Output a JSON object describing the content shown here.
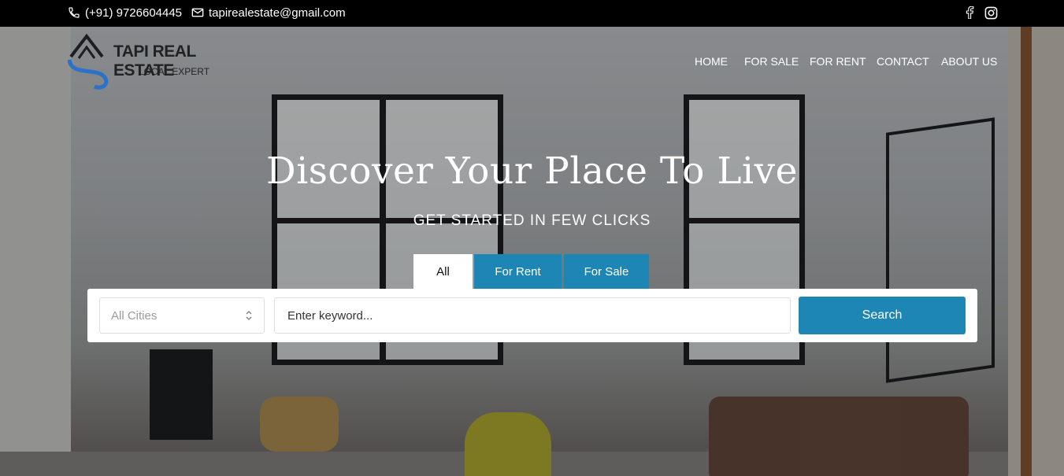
{
  "topbar": {
    "phone": "(+91) 9726604445",
    "email": "tapirealestate@gmail.com",
    "social": [
      "facebook-icon",
      "instagram-icon"
    ]
  },
  "brand": {
    "name": "TAPI REAL ESTATE",
    "tagline": "LOCAL EXPERT"
  },
  "nav": {
    "items": [
      "HOME",
      "FOR SALE",
      "FOR RENT",
      "CONTACT",
      "ABOUT US"
    ]
  },
  "hero": {
    "title": "Discover Your Place To Live",
    "subtitle": "GET STARTED IN FEW CLICKS"
  },
  "search": {
    "tabs": [
      "All",
      "For Rent",
      "For Sale"
    ],
    "active_tab": "All",
    "city_select": "All Cities",
    "keyword_placeholder": "Enter keyword...",
    "button_label": "Search"
  },
  "colors": {
    "accent": "#1e86b5",
    "topbar": "#000000"
  }
}
